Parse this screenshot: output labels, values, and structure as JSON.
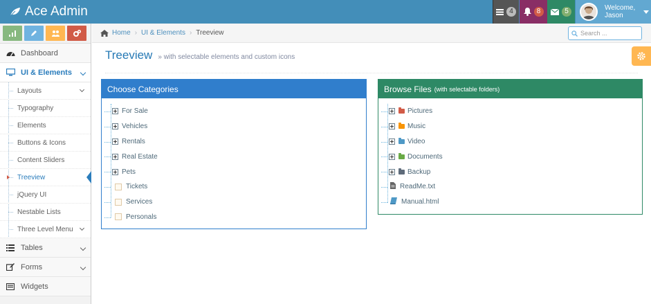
{
  "navbar": {
    "brand": "Ace Admin",
    "tasks_count": "4",
    "notifications_count": "8",
    "messages_count": "5",
    "welcome": "Welcome,",
    "username": "Jason"
  },
  "sidebar": {
    "items": [
      {
        "label": "Dashboard"
      },
      {
        "label": "UI & Elements"
      },
      {
        "label": "Tables"
      },
      {
        "label": "Forms"
      },
      {
        "label": "Widgets"
      }
    ],
    "submenu": [
      {
        "label": "Layouts"
      },
      {
        "label": "Typography"
      },
      {
        "label": "Elements"
      },
      {
        "label": "Buttons & Icons"
      },
      {
        "label": "Content Sliders"
      },
      {
        "label": "Treeview"
      },
      {
        "label": "jQuery UI"
      },
      {
        "label": "Nestable Lists"
      },
      {
        "label": "Three Level Menu"
      }
    ]
  },
  "breadcrumb": {
    "home": "Home",
    "section": "UI & Elements",
    "current": "Treeview",
    "search_placeholder": "Search ..."
  },
  "page": {
    "title": "Treeview",
    "subtitle": "with selectable elements and custom icons"
  },
  "categories": {
    "title": "Choose Categories",
    "items": [
      {
        "label": "For Sale"
      },
      {
        "label": "Vehicles"
      },
      {
        "label": "Rentals"
      },
      {
        "label": "Real Estate"
      },
      {
        "label": "Pets"
      },
      {
        "label": "Tickets"
      },
      {
        "label": "Services"
      },
      {
        "label": "Personals"
      }
    ]
  },
  "files": {
    "title": "Browse Files",
    "title_small": "(with selectable folders)",
    "items": [
      {
        "label": "Pictures",
        "color": "#d15b47"
      },
      {
        "label": "Music",
        "color": "#f89406"
      },
      {
        "label": "Video",
        "color": "#4f99c6"
      },
      {
        "label": "Documents",
        "color": "#69aa46"
      },
      {
        "label": "Backup",
        "color": "#5e6b7a"
      },
      {
        "label": "ReadMe.txt"
      },
      {
        "label": "Manual.html"
      }
    ]
  }
}
